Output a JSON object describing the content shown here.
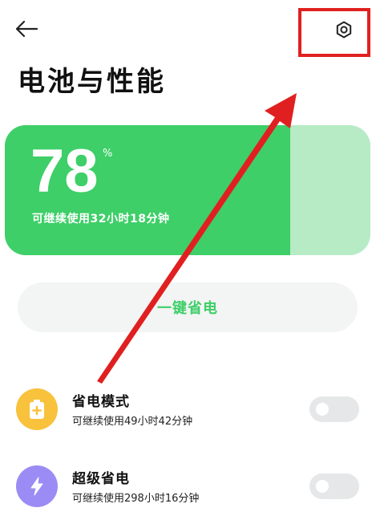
{
  "header": {
    "title": "电池与性能",
    "back_icon": "back-arrow-icon",
    "settings_icon": "hexagon-gear-icon"
  },
  "battery": {
    "level": "78",
    "unit": "%",
    "level_fraction": 0.78,
    "remaining": "可继续使用32小时18分钟",
    "fill_color": "#3ecf68",
    "track_color": "#b6ebc6"
  },
  "one_tap": {
    "label": "一键省电",
    "color": "#3ecf68"
  },
  "modes": [
    {
      "title": "省电模式",
      "subtitle": "可继续使用49小时42分钟",
      "icon": "battery-plus-icon",
      "icon_color": "#f9c23c",
      "enabled": false
    },
    {
      "title": "超级省电",
      "subtitle": "可继续使用298小时16分钟",
      "icon": "lightning-bolt-icon",
      "icon_color": "#9b8cf5",
      "enabled": false
    }
  ],
  "annotation": {
    "color": "#e02020"
  }
}
